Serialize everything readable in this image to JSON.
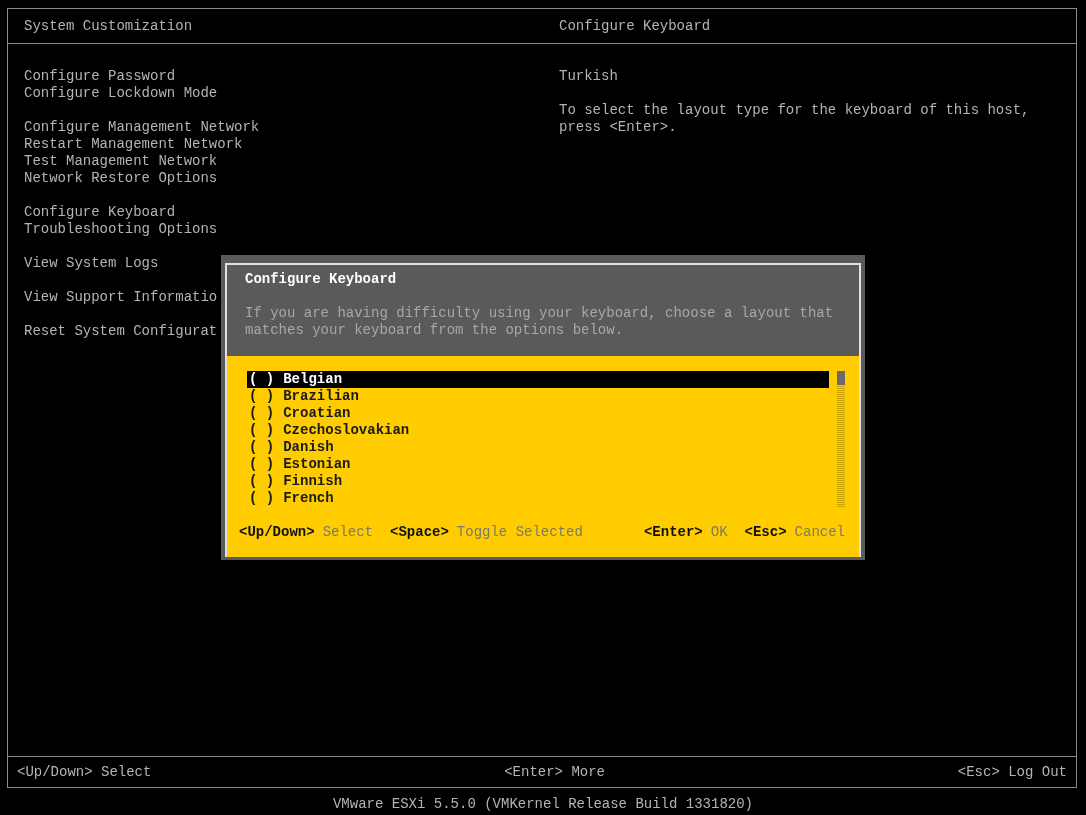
{
  "header": {
    "left_title": "System Customization",
    "right_title": "Configure Keyboard"
  },
  "menu_groups": [
    {
      "items": [
        "Configure Password",
        "Configure Lockdown Mode"
      ]
    },
    {
      "items": [
        "Configure Management Network",
        "Restart Management Network",
        "Test Management Network",
        "Network Restore Options"
      ]
    },
    {
      "items": [
        "Configure Keyboard",
        "Troubleshooting Options"
      ]
    },
    {
      "items": [
        "View System Logs"
      ]
    },
    {
      "items": [
        "View Support Informatio"
      ]
    },
    {
      "items": [
        "Reset System Configurat"
      ]
    }
  ],
  "detail": {
    "value": "Turkish",
    "description": "To select the layout type for the keyboard of this host, press <Enter>."
  },
  "dialog": {
    "title": "Configure Keyboard",
    "description": "If you are having difficulty using your keyboard, choose a layout that matches your keyboard from the options below.",
    "options": [
      {
        "radio": "( )",
        "label": "Belgian",
        "selected": true
      },
      {
        "radio": "( )",
        "label": "Brazilian",
        "selected": false
      },
      {
        "radio": "( )",
        "label": "Croatian",
        "selected": false
      },
      {
        "radio": "( )",
        "label": "Czechoslovakian",
        "selected": false
      },
      {
        "radio": "( )",
        "label": "Danish",
        "selected": false
      },
      {
        "radio": "( )",
        "label": "Estonian",
        "selected": false
      },
      {
        "radio": "( )",
        "label": "Finnish",
        "selected": false
      },
      {
        "radio": "( )",
        "label": "French",
        "selected": false
      }
    ],
    "hints_left": [
      {
        "key": "<Up/Down>",
        "action": "Select"
      },
      {
        "key": "<Space>",
        "action": "Toggle Selected"
      }
    ],
    "hints_right": [
      {
        "key": "<Enter>",
        "action": "OK"
      },
      {
        "key": "<Esc>",
        "action": "Cancel"
      }
    ]
  },
  "footer": {
    "left": "<Up/Down> Select",
    "center": "<Enter> More",
    "right": "<Esc> Log Out"
  },
  "version": "VMware ESXi 5.5.0 (VMKernel Release Build 1331820)"
}
